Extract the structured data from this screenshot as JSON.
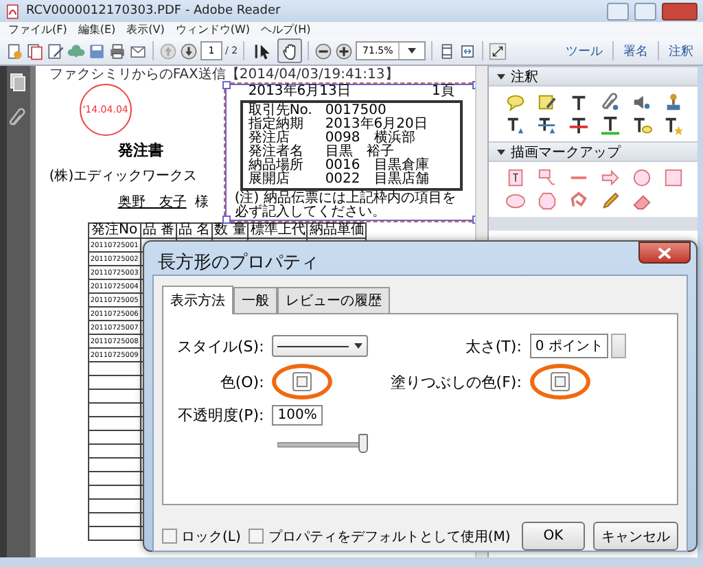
{
  "window": {
    "title": "RCV0000012170303.PDF - Adobe Reader"
  },
  "menu": [
    "ファイル(F)",
    "編集(E)",
    "表示(V)",
    "ウィンドウ(W)",
    "ヘルプ(H)"
  ],
  "toolbar": {
    "page": "1",
    "page_count": "/ 2",
    "zoom": "71.5%",
    "tools": [
      {
        "selected": false
      },
      {
        "selected": true
      }
    ],
    "panes": [
      "ツール",
      "署名",
      "注釈"
    ]
  },
  "document": {
    "header": "ファクシミリからのFAX送信【2014/04/03/19:41:13】",
    "stamp": "'14.04.04",
    "heading": "発注書",
    "company": "(株)エディックワークス",
    "recipient": "奥野　友子",
    "honorific": "様",
    "slip": {
      "date": "2013年6月13日",
      "page": "1頁",
      "fields": [
        {
          "label": "取引先No.",
          "value": "0017500"
        },
        {
          "label": "指定納期",
          "value": "2013年6月20日"
        },
        {
          "label": "発注店",
          "value": "0098　横浜部"
        },
        {
          "label": "発注者名",
          "value": "目黒　裕子"
        },
        {
          "label": "納品場所",
          "value": "0016　目黒倉庫"
        },
        {
          "label": "展開店",
          "value": "0022　目黒店舗"
        }
      ],
      "note": "(注) 納品伝票には上記枠内の項目を必ず記入してください。"
    },
    "table": {
      "columns": [
        "発注No",
        "品 番",
        "品 名",
        "数 量",
        "標準上代",
        "納品単価"
      ],
      "rows": [
        "20110725001",
        "20110725002",
        "20110725003",
        "20110725004",
        "20110725005",
        "20110725006",
        "20110725007",
        "20110725008",
        "20110725009"
      ]
    }
  },
  "panel": {
    "sections": [
      {
        "title": "注釈",
        "expanded": true
      },
      {
        "title": "描画マークアップ",
        "expanded": true
      }
    ]
  },
  "dialog": {
    "title": "長方形のプロパティ",
    "tabs": [
      {
        "label": "表示方法",
        "selected": true
      },
      {
        "label": "一般",
        "selected": false
      },
      {
        "label": "レビューの履歴",
        "selected": false
      }
    ],
    "style_label": "スタイル(S):",
    "weight_label": "太さ(T):",
    "weight": "0 ポイント",
    "color_label": "色(O):",
    "fill_label": "塗りつぶしの色(F):",
    "opacity_label": "不透明度(P):",
    "opacity": "100%",
    "opacity_slider": {
      "level": 1
    },
    "checkboxes": [
      {
        "label": "ロック(L)",
        "checked": false
      },
      {
        "label": "プロパティをデフォルトとして使用(M)",
        "checked": false
      }
    ],
    "buttons": [
      "OK",
      "キャンセル"
    ]
  }
}
